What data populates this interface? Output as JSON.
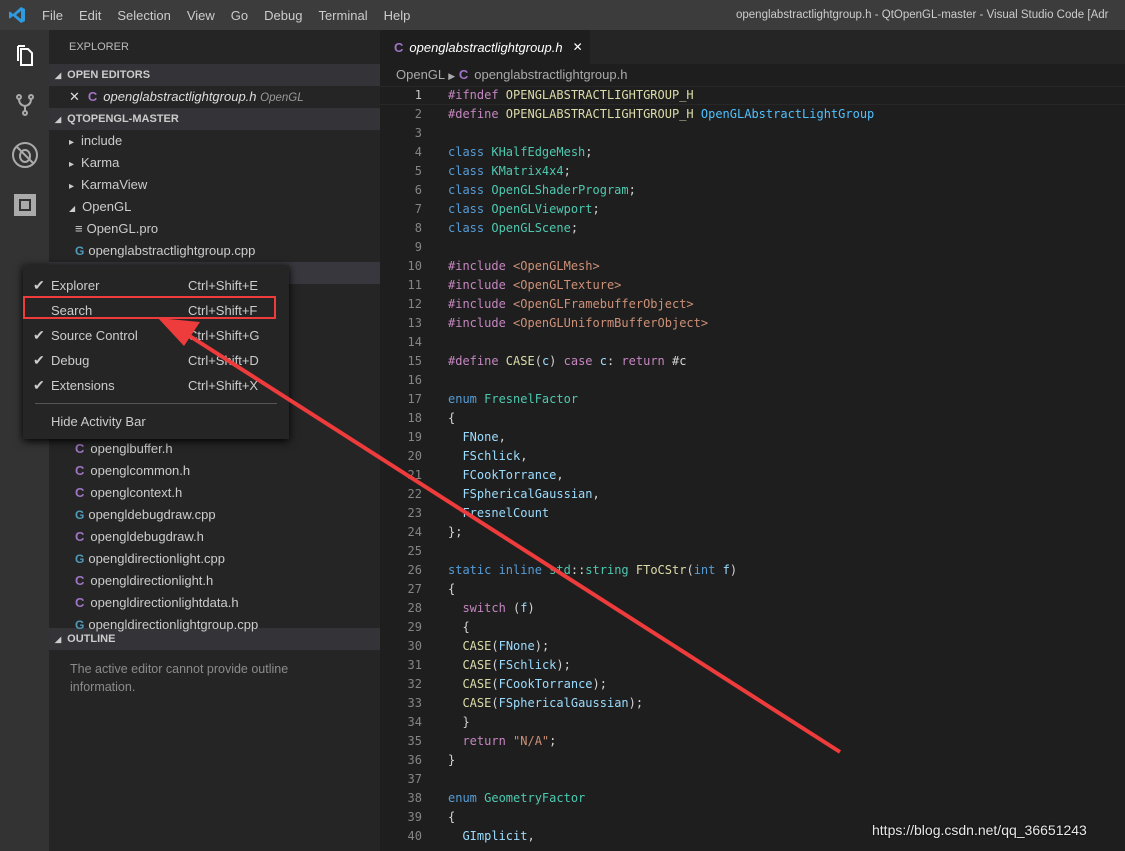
{
  "menubar": {
    "items": [
      "File",
      "Edit",
      "Selection",
      "View",
      "Go",
      "Debug",
      "Terminal",
      "Help"
    ],
    "window_title": "openglabstractlightgroup.h - QtOpenGL-master - Visual Studio Code [Adr"
  },
  "activity": [
    "files-icon",
    "source-control-icon",
    "debug-icon",
    "extensions-icon"
  ],
  "sidebar": {
    "title": "EXPLORER",
    "open_editors": "OPEN EDITORS",
    "open_file": "openglabstractlightgroup.h",
    "open_file_dir": "OpenGL",
    "project": "QTOPENGL-MASTER",
    "tree_top": [
      {
        "label": "include",
        "type": "folder"
      },
      {
        "label": "Karma",
        "type": "folder"
      },
      {
        "label": "KarmaView",
        "type": "folder"
      },
      {
        "label": "OpenGL",
        "type": "folder-open"
      },
      {
        "label": "OpenGL.pro",
        "type": "pro"
      },
      {
        "label": "openglabstractlightgroup.cpp",
        "type": "cpp"
      }
    ],
    "tree_bottom": [
      {
        "label": "openglbuffer.h",
        "type": "h"
      },
      {
        "label": "openglcommon.h",
        "type": "h"
      },
      {
        "label": "openglcontext.h",
        "type": "h"
      },
      {
        "label": "opengldebugdraw.cpp",
        "type": "cpp"
      },
      {
        "label": "opengldebugdraw.h",
        "type": "h"
      },
      {
        "label": "opengldirectionlight.cpp",
        "type": "cpp"
      },
      {
        "label": "opengldirectionlight.h",
        "type": "h"
      },
      {
        "label": "opengldirectionlightdata.h",
        "type": "h"
      },
      {
        "label": "opengldirectionlightgroup.cpp",
        "type": "cpp"
      }
    ],
    "outline": "OUTLINE",
    "outline_msg": "The active editor cannot provide outline information."
  },
  "editor": {
    "tab": "openglabstractlightgroup.h",
    "breadcrumb": [
      "OpenGL",
      "openglabstractlightgroup.h"
    ],
    "lines": [
      [
        [
          "pp",
          "#ifndef "
        ],
        [
          "mac",
          "OPENGLABSTRACTLIGHTGROUP_H"
        ]
      ],
      [
        [
          "pp",
          "#define "
        ],
        [
          "mac",
          "OPENGLABSTRACTLIGHTGROUP_H "
        ],
        [
          "lb",
          "OpenGLAbstractLightGroup"
        ]
      ],
      [],
      [
        [
          "kw",
          "class "
        ],
        [
          "ty",
          "KHalfEdgeMesh"
        ],
        [
          "pl",
          ";"
        ]
      ],
      [
        [
          "kw",
          "class "
        ],
        [
          "ty",
          "KMatrix4x4"
        ],
        [
          "pl",
          ";"
        ]
      ],
      [
        [
          "kw",
          "class "
        ],
        [
          "ty",
          "OpenGLShaderProgram"
        ],
        [
          "pl",
          ";"
        ]
      ],
      [
        [
          "kw",
          "class "
        ],
        [
          "ty",
          "OpenGLViewport"
        ],
        [
          "pl",
          ";"
        ]
      ],
      [
        [
          "kw",
          "class "
        ],
        [
          "ty",
          "OpenGLScene"
        ],
        [
          "pl",
          ";"
        ]
      ],
      [],
      [
        [
          "pp",
          "#include "
        ],
        [
          "str",
          "<OpenGLMesh>"
        ]
      ],
      [
        [
          "pp",
          "#include "
        ],
        [
          "str",
          "<OpenGLTexture>"
        ]
      ],
      [
        [
          "pp",
          "#include "
        ],
        [
          "str",
          "<OpenGLFramebufferObject>"
        ]
      ],
      [
        [
          "pp",
          "#include "
        ],
        [
          "str",
          "<OpenGLUniformBufferObject>"
        ]
      ],
      [],
      [
        [
          "pp",
          "#define "
        ],
        [
          "mac",
          "CASE"
        ],
        [
          "pl",
          "("
        ],
        [
          "var",
          "c"
        ],
        [
          "pl",
          ") "
        ],
        [
          "pp",
          "case "
        ],
        [
          "var",
          "c"
        ],
        [
          "pl",
          ": "
        ],
        [
          "pp",
          "return "
        ],
        [
          "pl",
          "#c"
        ]
      ],
      [],
      [
        [
          "kw",
          "enum "
        ],
        [
          "ty",
          "FresnelFactor"
        ]
      ],
      [
        [
          "pl",
          "{"
        ]
      ],
      [
        [
          "pl",
          "  "
        ],
        [
          "var",
          "FNone"
        ],
        [
          "pl",
          ","
        ]
      ],
      [
        [
          "pl",
          "  "
        ],
        [
          "var",
          "FSchlick"
        ],
        [
          "pl",
          ","
        ]
      ],
      [
        [
          "pl",
          "  "
        ],
        [
          "var",
          "FCookTorrance"
        ],
        [
          "pl",
          ","
        ]
      ],
      [
        [
          "pl",
          "  "
        ],
        [
          "var",
          "FSphericalGaussian"
        ],
        [
          "pl",
          ","
        ]
      ],
      [
        [
          "pl",
          "  "
        ],
        [
          "var",
          "FresnelCount"
        ]
      ],
      [
        [
          "pl",
          "};"
        ]
      ],
      [],
      [
        [
          "kw",
          "static inline "
        ],
        [
          "ty",
          "std"
        ],
        [
          "pl",
          "::"
        ],
        [
          "ty",
          "string "
        ],
        [
          "fn",
          "FToCStr"
        ],
        [
          "pl",
          "("
        ],
        [
          "kw",
          "int "
        ],
        [
          "var",
          "f"
        ],
        [
          "pl",
          ")"
        ]
      ],
      [
        [
          "pl",
          "{"
        ]
      ],
      [
        [
          "pl",
          "  "
        ],
        [
          "pp",
          "switch "
        ],
        [
          "pl",
          "("
        ],
        [
          "var",
          "f"
        ],
        [
          "pl",
          ")"
        ]
      ],
      [
        [
          "pl",
          "  {"
        ]
      ],
      [
        [
          "pl",
          "  "
        ],
        [
          "mac",
          "CASE"
        ],
        [
          "pl",
          "("
        ],
        [
          "var",
          "FNone"
        ],
        [
          "pl",
          ");"
        ]
      ],
      [
        [
          "pl",
          "  "
        ],
        [
          "mac",
          "CASE"
        ],
        [
          "pl",
          "("
        ],
        [
          "var",
          "FSchlick"
        ],
        [
          "pl",
          ");"
        ]
      ],
      [
        [
          "pl",
          "  "
        ],
        [
          "mac",
          "CASE"
        ],
        [
          "pl",
          "("
        ],
        [
          "var",
          "FCookTorrance"
        ],
        [
          "pl",
          ");"
        ]
      ],
      [
        [
          "pl",
          "  "
        ],
        [
          "mac",
          "CASE"
        ],
        [
          "pl",
          "("
        ],
        [
          "var",
          "FSphericalGaussian"
        ],
        [
          "pl",
          ");"
        ]
      ],
      [
        [
          "pl",
          "  }"
        ]
      ],
      [
        [
          "pl",
          "  "
        ],
        [
          "pp",
          "return "
        ],
        [
          "str",
          "\"N/A\""
        ],
        [
          "pl",
          ";"
        ]
      ],
      [
        [
          "pl",
          "}"
        ]
      ],
      [],
      [
        [
          "kw",
          "enum "
        ],
        [
          "ty",
          "GeometryFactor"
        ]
      ],
      [
        [
          "pl",
          "{"
        ]
      ],
      [
        [
          "pl",
          "  "
        ],
        [
          "var",
          "GImplicit"
        ],
        [
          "pl",
          ","
        ]
      ]
    ]
  },
  "context_menu": {
    "items": [
      {
        "label": "Explorer",
        "shortcut": "Ctrl+Shift+E",
        "checked": true
      },
      {
        "label": "Search",
        "shortcut": "Ctrl+Shift+F",
        "checked": false
      },
      {
        "label": "Source Control",
        "shortcut": "Ctrl+Shift+G",
        "checked": true
      },
      {
        "label": "Debug",
        "shortcut": "Ctrl+Shift+D",
        "checked": true
      },
      {
        "label": "Extensions",
        "shortcut": "Ctrl+Shift+X",
        "checked": true
      }
    ],
    "hide": "Hide Activity Bar"
  },
  "annotation": {
    "color": "#ee3b3b",
    "highlighted": "Search"
  },
  "watermark": "https://blog.csdn.net/qq_36651243"
}
